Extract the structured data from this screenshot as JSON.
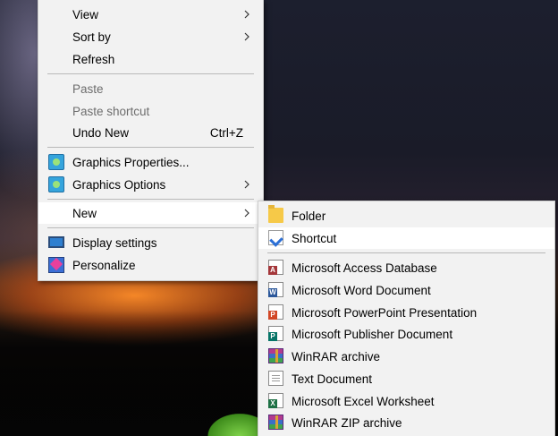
{
  "context_menu": {
    "items": [
      {
        "label": "View",
        "has_submenu": true
      },
      {
        "label": "Sort by",
        "has_submenu": true
      },
      {
        "label": "Refresh"
      },
      {
        "label": "Paste",
        "disabled": true
      },
      {
        "label": "Paste shortcut",
        "disabled": true
      },
      {
        "label": "Undo New",
        "shortcut": "Ctrl+Z"
      },
      {
        "label": "Graphics Properties...",
        "icon": "graphics-icon"
      },
      {
        "label": "Graphics Options",
        "icon": "graphics-icon",
        "has_submenu": true
      },
      {
        "label": "New",
        "has_submenu": true,
        "highlighted": true
      },
      {
        "label": "Display settings",
        "icon": "display-settings-icon"
      },
      {
        "label": "Personalize",
        "icon": "personalize-icon"
      }
    ]
  },
  "new_submenu": {
    "items": [
      {
        "label": "Folder",
        "icon": "folder-icon"
      },
      {
        "label": "Shortcut",
        "icon": "shortcut-icon",
        "highlighted": true
      },
      {
        "label": "Microsoft Access Database",
        "icon": "access-icon"
      },
      {
        "label": "Microsoft Word Document",
        "icon": "word-icon"
      },
      {
        "label": "Microsoft PowerPoint Presentation",
        "icon": "powerpoint-icon"
      },
      {
        "label": "Microsoft Publisher Document",
        "icon": "publisher-icon"
      },
      {
        "label": "WinRAR archive",
        "icon": "winrar-icon"
      },
      {
        "label": "Text Document",
        "icon": "text-document-icon"
      },
      {
        "label": "Microsoft Excel Worksheet",
        "icon": "excel-icon"
      },
      {
        "label": "WinRAR ZIP archive",
        "icon": "winrar-zip-icon"
      }
    ]
  },
  "colors": {
    "menu_background": "#f2f2f2",
    "highlight": "#ffffff",
    "disabled_text": "#6d6d6d",
    "separator": "#b9b9b9"
  }
}
